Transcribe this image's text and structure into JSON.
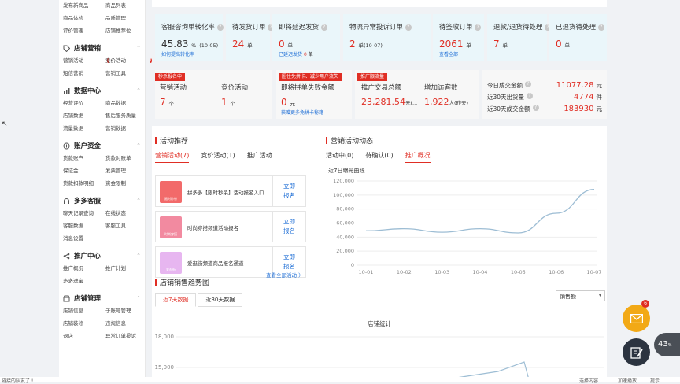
{
  "sidebar": {
    "top_items": [
      "发布新商品",
      "商品列表",
      "商品体检",
      "品质管理",
      "评价管理",
      "店铺推荐位"
    ],
    "sections": [
      {
        "title": "店铺营销",
        "items": [
          "营销活动",
          "竞价活动",
          "短信营销",
          "营销工具"
        ],
        "badges": {
          "0": "7",
          "1": "1"
        }
      },
      {
        "title": "数据中心",
        "items": [
          "经营评价",
          "商品数据",
          "店铺数据",
          "售后服务质量",
          "流量数据",
          "营销数据"
        ],
        "badges": {
          "5": ""
        }
      },
      {
        "title": "账户资金",
        "items": [
          "货款账户",
          "货款对账单",
          "保证金",
          "发票管理",
          "货款扣款明细",
          "资金限制"
        ]
      },
      {
        "title": "多多客服",
        "items": [
          "聊天记录查询",
          "在线状态",
          "客服数据",
          "客服工具",
          "消息设置"
        ],
        "badges": {
          "4": ""
        }
      },
      {
        "title": "推广中心",
        "items": [
          "推广概况",
          "推广计划",
          "多多进宝"
        ]
      },
      {
        "title": "店铺管理",
        "items": [
          "店铺信息",
          "子账号管理",
          "店铺装修",
          "违规信息",
          "退店",
          "异常订单投诉"
        ]
      }
    ]
  },
  "stats": [
    {
      "label": "客服咨询单转化率",
      "value": "45.83",
      "unit": "%",
      "extra": "(10-05)",
      "sub": "如何提高转化率"
    },
    {
      "label": "待发货订单",
      "value": "24",
      "unit": "单"
    },
    {
      "label": "即将延迟发货",
      "value": "0",
      "unit": "单",
      "sub": "已延迟发货",
      "sub_value": "0",
      "sub_unit": "单"
    },
    {
      "label": "物流异常投诉订单",
      "value": "2",
      "unit": "单(10-07)"
    },
    {
      "label": "待签收订单",
      "value": "2061",
      "unit": "单",
      "sub": "查看全部"
    },
    {
      "label": "退款/退货待处理",
      "value": "7",
      "unit": "单"
    },
    {
      "label": "已退货待处理",
      "value": "0",
      "unit": "单"
    }
  ],
  "promo": {
    "tag1": "秒杀报名中",
    "tag2": "圈住免拼卡、减少用户流失",
    "tag3": "推广限流量",
    "marketing_label": "营销活动",
    "marketing_value": "7",
    "marketing_unit": "个",
    "bid_label": "竞价活动",
    "bid_value": "1",
    "bid_unit": "个",
    "fail_label": "即将拼单失败金额",
    "fail_value": "0",
    "fail_unit": "元",
    "fail_link": "获赠更多免拼卡秘籍",
    "gmv_label": "推广交易总额",
    "gmv_value": "23,281.54",
    "gmv_unit": "元(...",
    "visitors_label": "增加访客数",
    "visitors_value": "1,922",
    "visitors_unit": "人(昨天)"
  },
  "sales": {
    "today_label": "今日成交金额",
    "today_value": "11077.28",
    "today_unit": "元",
    "orders30_label": "近30天出货量",
    "orders30_value": "4774",
    "orders30_unit": "件",
    "gmv30_label": "近30天成交金额",
    "gmv30_value": "183930",
    "gmv30_unit": "元"
  },
  "recommend": {
    "title": "活动推荐",
    "tabs": [
      "营销活动(7)",
      "竞价活动(1)",
      "推广活动"
    ],
    "items": [
      {
        "text": "拼多多【限时秒杀】活动报名入口",
        "button": "立即报名",
        "thumb_label": "限时秒杀"
      },
      {
        "text": "时尚穿搭频道活动报名",
        "button": "立即报名",
        "thumb_label": "时尚穿搭"
      },
      {
        "text": "爱逛街频道商品报名通道",
        "button": "立即报名",
        "thumb_label": "爱逛街"
      }
    ],
    "more": "查看全部活动 〉"
  },
  "dynamics": {
    "title": "营销活动动态",
    "tabs": [
      "活动中(0)",
      "待确认(0)",
      "推广概况"
    ],
    "chart_title": "近7日曝光曲线"
  },
  "chart_data": {
    "type": "line",
    "title": "近7日曝光曲线",
    "categories": [
      "10-01",
      "10-02",
      "10-03",
      "10-04",
      "10-05",
      "10-06",
      "10-07"
    ],
    "series": [
      {
        "values": [
          49000,
          52000,
          47000,
          52000,
          46000,
          74000,
          108000
        ]
      }
    ],
    "yticks": [
      "0",
      "20,000",
      "40,000",
      "60,000",
      "80,000",
      "100,000",
      "120,000"
    ],
    "ylim": [
      0,
      120000
    ],
    "color": "#9dbdd4"
  },
  "trend": {
    "title": "店铺销售趋势图",
    "tabs": [
      "近7天数据",
      "近30天数据"
    ],
    "select": "销售额",
    "chart_title": "店铺统计",
    "yticks": [
      "18,000",
      "15,000"
    ]
  },
  "float": {
    "mail_badge": "6",
    "progress": "43"
  },
  "status": {
    "left": "链接的队友了 !",
    "right1": "选择内容",
    "right2": "加速播放",
    "right3": "提示"
  },
  "colors": {
    "accent": "#e02e24",
    "link": "#1f6fd6",
    "card": "#eaf6fa"
  }
}
